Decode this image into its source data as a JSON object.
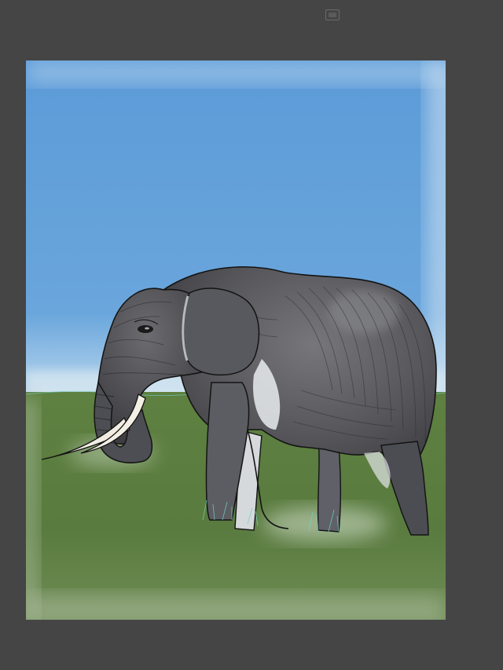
{
  "app": {
    "background_color": "#454545"
  },
  "toolbar": {
    "window_icon": "window-icon"
  },
  "canvas": {
    "subject": "elephant-illustration",
    "colors": {
      "sky": "#5b9ad6",
      "sky_light": "#a9cbe9",
      "grass": "#5f7f43",
      "grass_dark": "#4f6e38",
      "elephant_body": "#5b5b5f",
      "elephant_shadow": "#3c3c40",
      "tusk": "#f1ece2",
      "outline": "#141414"
    }
  }
}
